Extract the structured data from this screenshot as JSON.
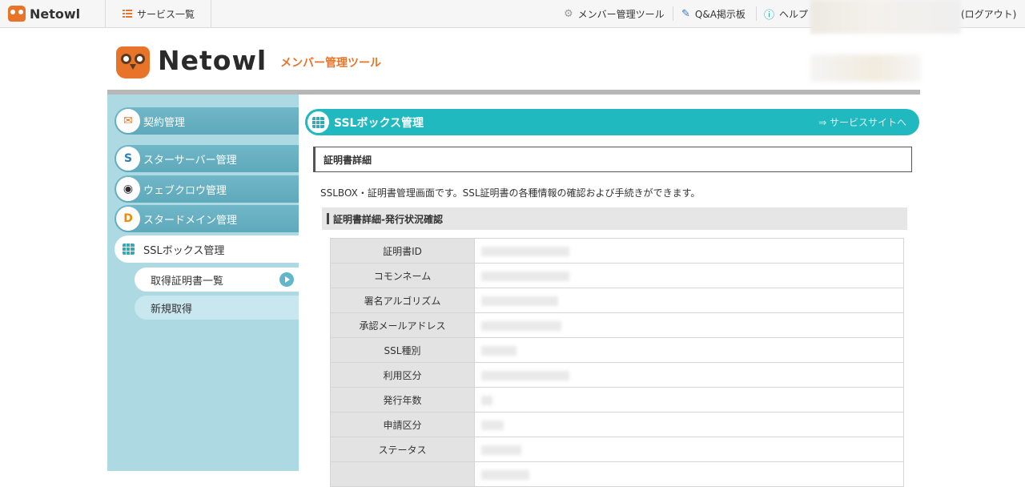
{
  "topbar": {
    "logo_text": "Netowl",
    "services": "サービス一覧",
    "member_tool": "メンバー管理ツール",
    "qa": "Q&A掲示板",
    "help": "ヘルプ",
    "logout": "(ログアウト)"
  },
  "header": {
    "brand": "Netowl",
    "subtitle": "メンバー管理ツール"
  },
  "sidebar": {
    "items": [
      {
        "label": "契約管理",
        "icon": "contract-icon"
      },
      {
        "label": "スターサーバー管理",
        "icon": "star-server-icon"
      },
      {
        "label": "ウェブクロウ管理",
        "icon": "webcrow-icon"
      },
      {
        "label": "スタードメイン管理",
        "icon": "star-domain-icon"
      },
      {
        "label": "SSLボックス管理",
        "icon": "ssl-box-icon"
      }
    ],
    "sub_items": [
      {
        "label": "取得証明書一覧"
      },
      {
        "label": "新規取得"
      }
    ]
  },
  "main": {
    "title": "SSLボックス管理",
    "title_link": "⇒ サービスサイトへ",
    "section": "証明書詳細",
    "description": "SSLBOX・証明書管理画面です。SSL証明書の各種情報の確認および手続きができます。",
    "subheading": "証明書詳細-発行状況確認",
    "rows": [
      {
        "label": "証明書ID"
      },
      {
        "label": "コモンネーム"
      },
      {
        "label": "署名アルゴリズム"
      },
      {
        "label": "承認メールアドレス"
      },
      {
        "label": "SSL種別"
      },
      {
        "label": "利用区分"
      },
      {
        "label": "発行年数"
      },
      {
        "label": "申請区分"
      },
      {
        "label": "ステータス"
      },
      {
        "label": ""
      }
    ]
  },
  "colors": {
    "accent": "#e8742a",
    "teal": "#20b9bf",
    "sidebar_bg": "#add9e3",
    "sidebar_item": "#5ea9bb"
  }
}
